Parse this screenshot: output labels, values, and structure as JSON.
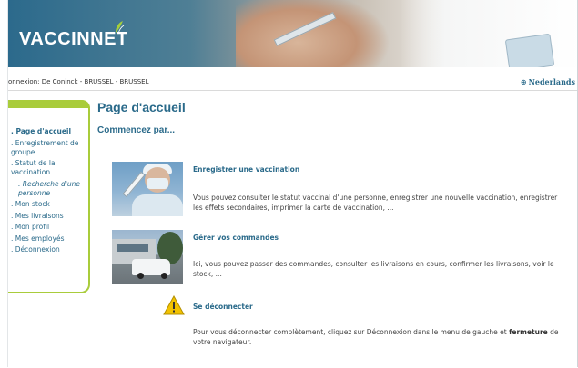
{
  "header": {
    "logo_text": "VACCINNET"
  },
  "status_bar": {
    "connection": "onnexion: De Coninck - BRUSSEL - BRUSSEL",
    "language_link": "Nederlands"
  },
  "sidebar": {
    "items": [
      {
        "label": "Page d'accueil",
        "active": true
      },
      {
        "label": "Enregistrement de groupe"
      },
      {
        "label": "Statut de la vaccination"
      },
      {
        "label": "Recherche d'une personne",
        "sub": true
      },
      {
        "label": "Mon stock"
      },
      {
        "label": "Mes livraisons"
      },
      {
        "label": "Mon profil"
      },
      {
        "label": "Mes employés"
      },
      {
        "label": "Déconnexion"
      }
    ]
  },
  "main": {
    "title": "Page d'accueil",
    "subtitle": "Commencez par...",
    "sections": [
      {
        "title": "Enregistrer une vaccination",
        "text": "Vous pouvez consulter le statut vaccinal d'une personne, enregistrer une nouvelle vaccination, enregistrer les effets secondaires, imprimer la carte de vaccination, ..."
      },
      {
        "title": "Gérer vos commandes",
        "text": "Ici, vous pouvez passer des commandes, consulter les livraisons en cours, confirmer les livraisons, voir le stock, ..."
      },
      {
        "title": "Se déconnecter",
        "text_before": "Pour vous déconnecter complètement, cliquez sur Déconnexion dans le menu de gauche et ",
        "text_bold": "fermeture",
        "text_after": " de votre navigateur."
      }
    ]
  },
  "colors": {
    "accent_blue": "#2a6a8a",
    "accent_green": "#a9cc3b",
    "warning_yellow": "#f2c200"
  },
  "icons": [
    "globe-icon",
    "warning-icon"
  ]
}
